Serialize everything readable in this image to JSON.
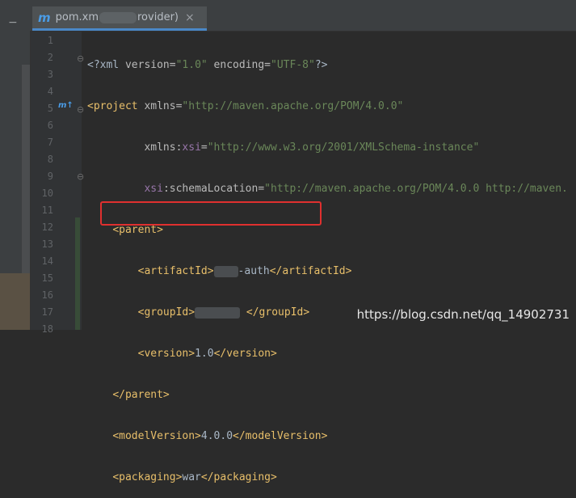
{
  "tab": {
    "prefix": "pom.xm",
    "suffix": "rovider)",
    "close_glyph": "×",
    "m_icon": "m",
    "icon_name": "maven-file-icon"
  },
  "gutter": {
    "line_numbers": [
      "1",
      "2",
      "3",
      "4",
      "5",
      "6",
      "7",
      "8",
      "9",
      "10",
      "11",
      "12",
      "13",
      "14",
      "15",
      "16",
      "17",
      "18"
    ],
    "override_marker": "m↑"
  },
  "code": {
    "l1": {
      "open": "<?xml ",
      "a1": "version=",
      "v1": "\"1.0\"",
      "a2": " encoding=",
      "v2": "\"UTF-8\"",
      "close": "?>"
    },
    "l2": {
      "tag": "<project ",
      "attr": "xmlns=",
      "val": "\"http://maven.apache.org/POM/4.0.0\""
    },
    "l3": {
      "attr": "xmlns:",
      "ns": "xsi",
      "eq": "=",
      "val": "\"http://www.w3.org/2001/XMLSchema-instance\""
    },
    "l4": {
      "ns": "xsi",
      "attr": ":schemaLocation=",
      "val": "\"http://maven.apache.org/POM/4.0.0 http://maven."
    },
    "l5": {
      "tag": "<parent>"
    },
    "l6": {
      "open": "<artifactId>",
      "text": "-auth",
      "close": "</artifactId>"
    },
    "l7": {
      "open": "<groupId>",
      "close": "</groupId>"
    },
    "l8": {
      "open": "<version>",
      "text": "1.0",
      "close": "</version>"
    },
    "l9": {
      "tag": "</parent>"
    },
    "l10": {
      "open": "<modelVersion>",
      "text": "4.0.0",
      "close": "</modelVersion>"
    },
    "l11": {
      "open": "<packaging>",
      "text": "war",
      "close": "</packaging>"
    }
  },
  "watermark": "https://blog.csdn.net/qq_14902731",
  "colors": {
    "background": "#2b2b2b",
    "tag": "#e8bf6a",
    "attribute": "#bababa",
    "string": "#6a8759",
    "namespace": "#9876aa",
    "highlight_box": "#e0302f"
  }
}
